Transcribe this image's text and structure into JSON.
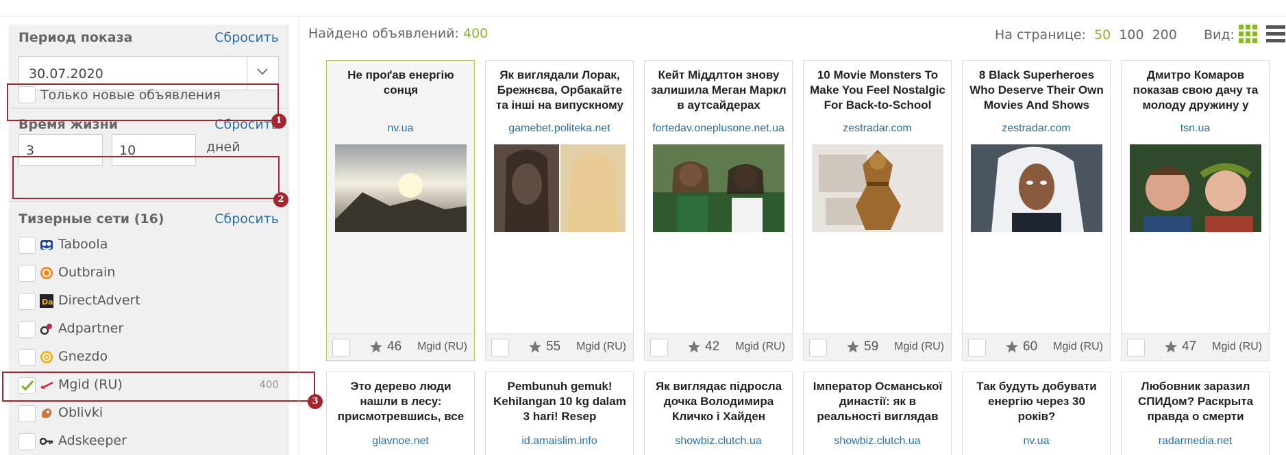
{
  "filters": {
    "period": {
      "title": "Период показа",
      "reset": "Сбросить",
      "date": "30.07.2020",
      "only_new_label": "Только новые объявления"
    },
    "lifetime": {
      "title": "Время жизни",
      "reset": "Сбросить",
      "from": "3",
      "to": "10",
      "unit": "дней"
    },
    "networks": {
      "title": "Тизерные сети (16)",
      "reset": "Сбросить",
      "items": [
        {
          "name": "Taboola",
          "icon": "taboola-icon",
          "checked": false,
          "count": ""
        },
        {
          "name": "Outbrain",
          "icon": "outbrain-icon",
          "checked": false,
          "count": ""
        },
        {
          "name": "DirectAdvert",
          "icon": "directadvert-icon",
          "checked": false,
          "count": ""
        },
        {
          "name": "Adpartner",
          "icon": "adpartner-icon",
          "checked": false,
          "count": ""
        },
        {
          "name": "Gnezdo",
          "icon": "gnezdo-icon",
          "checked": false,
          "count": ""
        },
        {
          "name": "Mgid (RU)",
          "icon": "mgid-icon",
          "checked": true,
          "count": "400"
        },
        {
          "name": "Oblivki",
          "icon": "oblivki-icon",
          "checked": false,
          "count": ""
        },
        {
          "name": "Adskeeper",
          "icon": "adskeeper-icon",
          "checked": false,
          "count": ""
        }
      ]
    }
  },
  "annotations": {
    "one": "1",
    "two": "2",
    "three": "3"
  },
  "results": {
    "found_label": "Найдено объявлений:",
    "found_count": "400",
    "per_page_label": "На странице:",
    "per_page_options": [
      "50",
      "100",
      "200"
    ],
    "per_page_active": "50",
    "view_label": "Вид:"
  },
  "cards_row1": [
    {
      "title": "Не проґав енергію сонця",
      "source": "nv.ua",
      "rating": "46",
      "network": "Mgid (RU)"
    },
    {
      "title": "Як виглядали Лорак, Брежнєва, Орбакайте та інші на випускному",
      "source": "gamebet.politeka.net",
      "rating": "55",
      "network": "Mgid (RU)"
    },
    {
      "title": "Кейт Міддлтон знову залишила Меган Маркл в аутсайдерах",
      "source": "fortedav.oneplusone.net.ua",
      "rating": "42",
      "network": "Mgid (RU)"
    },
    {
      "title": "10 Movie Monsters To Make You Feel Nostalgic For Back-to-School",
      "source": "zestradar.com",
      "rating": "59",
      "network": "Mgid (RU)"
    },
    {
      "title": "8 Black Superheroes Who Deserve Their Own Movies And Shows",
      "source": "zestradar.com",
      "rating": "60",
      "network": "Mgid (RU)"
    },
    {
      "title": "Дмитро Комаров показав свою дачу та молоду дружину у",
      "source": "tsn.ua",
      "rating": "47",
      "network": "Mgid (RU)"
    }
  ],
  "cards_row2": [
    {
      "title": "Это дерево люди нашли в лесу: присмотревшись, все",
      "source": "glavnoe.net"
    },
    {
      "title": "Pembunuh gemuk! Kehilangan 10 kg dalam 3 hari! Resep",
      "source": "id.amaislim.info"
    },
    {
      "title": "Як виглядає підросла дочка Володимира Кличко і Хайден",
      "source": "showbiz.clutch.ua"
    },
    {
      "title": "Імператор Османської династії: як в реальності виглядав",
      "source": "showbiz.clutch.ua"
    },
    {
      "title": "Так будуть добувати енергію через 30 років?",
      "source": "nv.ua"
    },
    {
      "title": "Любовник заразил СПИДом? Раскрыта правда о смерти",
      "source": "radarmedia.net"
    }
  ]
}
